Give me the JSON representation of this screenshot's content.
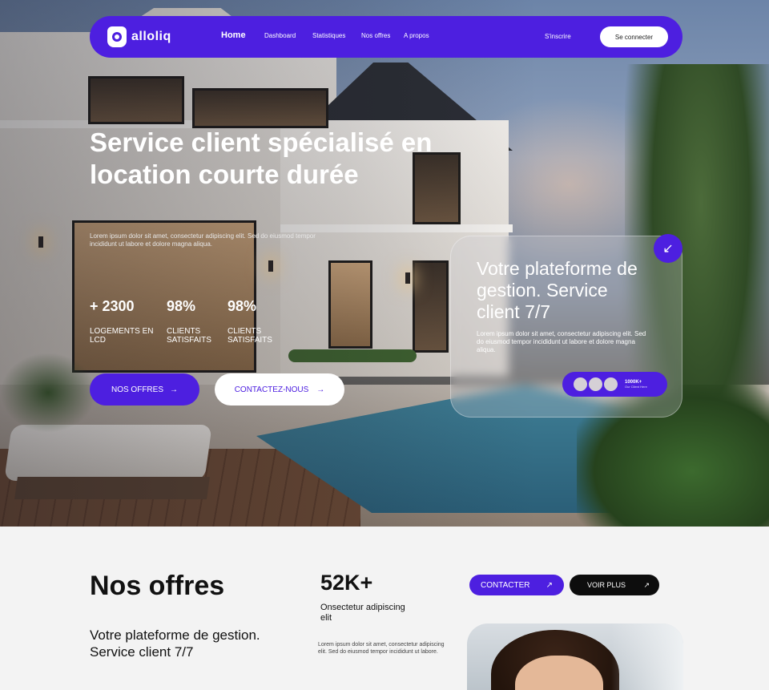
{
  "brand": {
    "logo_text": "alloliq",
    "accent": "#4d1fe0"
  },
  "nav": {
    "links": [
      "Home",
      "Dashboard",
      "Statistiques",
      "Nos offres",
      "A propos"
    ],
    "signup": "S'inscrire",
    "login": "Se connecter"
  },
  "hero": {
    "title": "Service client spécialisé en location courte durée",
    "description": "Lorem ipsum dolor sit amet, consectetur adipiscing elit. Sed do eiusmod tempor incididunt ut labore et dolore magna aliqua.",
    "stats": [
      {
        "value": "+ 2300",
        "label": "LOGEMENTS EN LCD"
      },
      {
        "value": "98%",
        "label": "CLIENTS SATISFAITS"
      },
      {
        "value": "98%",
        "label": "CLIENTS SATISFAITS"
      }
    ],
    "btn_offers": "NOS OFFRES",
    "btn_contact": "CONTACTEZ-NOUS"
  },
  "card": {
    "title": "Votre plateforme de gestion. Service client 7/7",
    "description": "Lorem ipsum dolor sit amet, consectetur adipiscing elit. Sed do eiusmod tempor incididunt ut labore et dolore magna aliqua.",
    "pill_count": "1000K+",
    "pill_sub": "Our Client Here"
  },
  "offers": {
    "title": "Nos offres",
    "subtitle": "Votre plateforme de gestion. Service client 7/7",
    "big_number": "52K+",
    "number_label": "Onsectetur adipiscing elit",
    "number_desc": "Lorem ipsum dolor sit amet, consectetur adipiscing elit. Sed do eiusmod tempor incididunt ut labore.",
    "btn_contact": "CONTACTER",
    "btn_more": "VOIR PLUS"
  }
}
